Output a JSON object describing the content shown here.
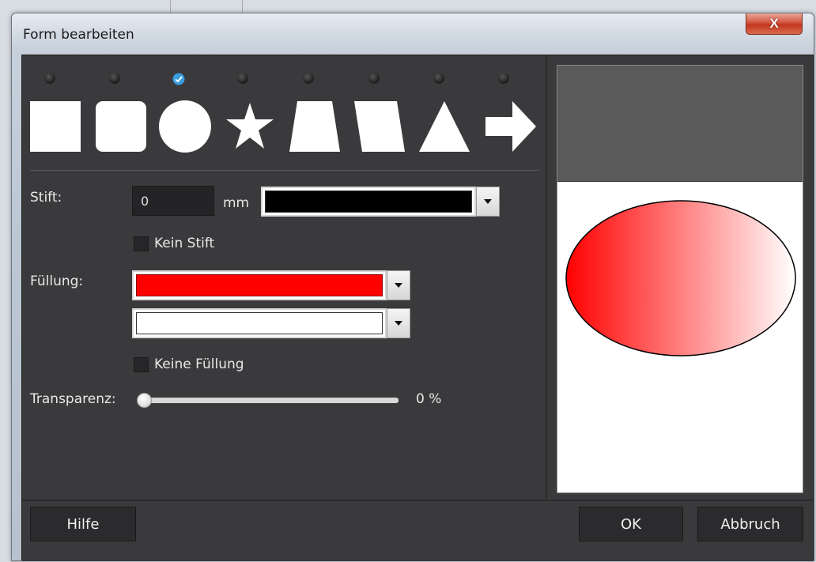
{
  "dialog": {
    "title": "Form bearbeiten",
    "close_label": "X"
  },
  "shapes": {
    "selected_index": 2,
    "items": [
      {
        "name": "square"
      },
      {
        "name": "rounded-square"
      },
      {
        "name": "circle"
      },
      {
        "name": "star"
      },
      {
        "name": "trapezoid"
      },
      {
        "name": "parallelogram"
      },
      {
        "name": "triangle"
      },
      {
        "name": "arrow-right"
      }
    ]
  },
  "stift": {
    "label": "Stift:",
    "value": "0",
    "unit": "mm",
    "color": "#000000",
    "no_pen_label": "Kein Stift",
    "no_pen_checked": false
  },
  "fuellung": {
    "label": "Füllung:",
    "color1": "#ff0000",
    "color2": "#ffffff",
    "no_fill_label": "Keine Füllung",
    "no_fill_checked": false
  },
  "transparenz": {
    "label": "Transparenz:",
    "value_text": "0 %",
    "value": 0
  },
  "buttons": {
    "help": "Hilfe",
    "ok": "OK",
    "cancel": "Abbruch"
  },
  "colors": {
    "accent_check": "#3a9de0",
    "panel_bg": "#3a3a3c"
  }
}
